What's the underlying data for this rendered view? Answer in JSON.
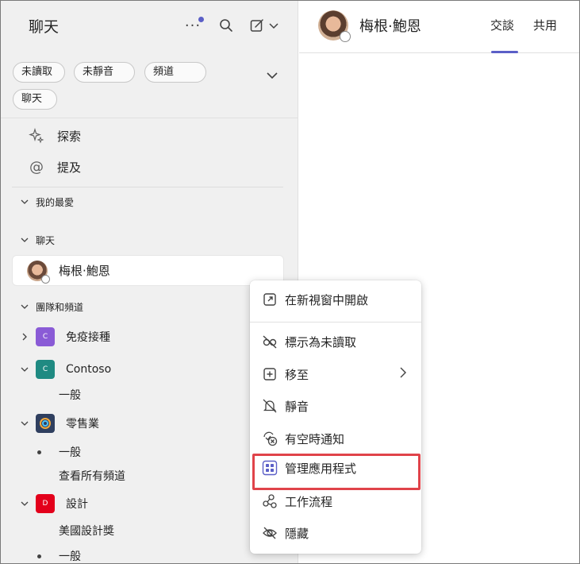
{
  "left": {
    "title": "聊天",
    "more_glyph": "···",
    "filters": [
      "未讀取",
      "未靜音",
      "頻道",
      "聊天"
    ],
    "explore_label": "探索",
    "mentions_label": "提及",
    "favorites_label": "我的最愛",
    "chats_label": "聊天",
    "chat_name": "梅根·鮑恩",
    "teams_label": "團隊和頻道",
    "teams": [
      {
        "name": "免疫接種",
        "initial": "C",
        "color": "#8a5bd6"
      },
      {
        "name": "Contoso",
        "initial": "C",
        "color": "#1f8a82"
      },
      {
        "name": "零售業",
        "initial": "",
        "color": "#2f3f5f"
      },
      {
        "name": "設計",
        "initial": "D",
        "color": "#e3001b"
      }
    ],
    "channels": {
      "contoso_general": "一般",
      "retail_general": "一般",
      "see_all": "查看所有頻道",
      "design_award": "美國設計獎",
      "design_general": "一般"
    }
  },
  "right": {
    "name": "梅根·鮑恩",
    "tabs": [
      "交談",
      "共用"
    ]
  },
  "menu": {
    "items": [
      {
        "label": "在新視窗中開啟",
        "icon": "open-window-icon"
      },
      {
        "label": "標示為未讀取",
        "icon": "unread-icon"
      },
      {
        "label": "移至",
        "icon": "move-icon"
      },
      {
        "label": "靜音",
        "icon": "mute-icon"
      },
      {
        "label": "有空時通知",
        "icon": "notify-icon"
      },
      {
        "label": "管理應用程式",
        "icon": "apps-icon"
      },
      {
        "label": "工作流程",
        "icon": "workflow-icon"
      },
      {
        "label": "隱藏",
        "icon": "hide-icon"
      }
    ]
  },
  "colors": {
    "accent": "#5b5fc7",
    "highlight": "#e0434a"
  }
}
